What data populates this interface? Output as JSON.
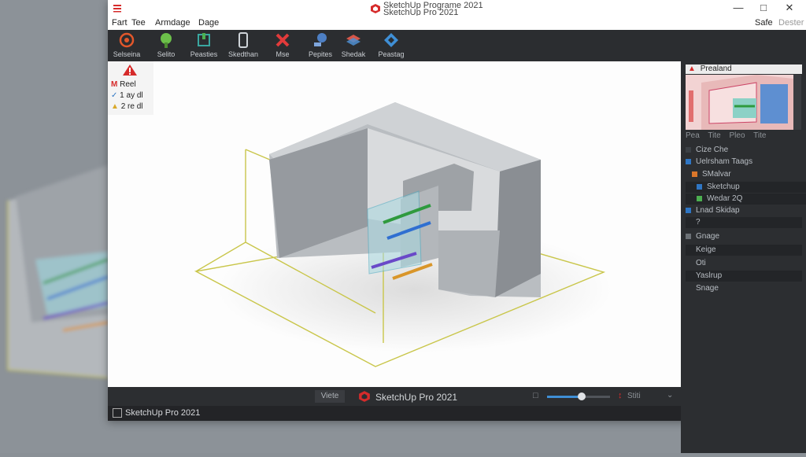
{
  "titlebar": {
    "title_line1": "SketchUp Programe 2021",
    "title_line2": "SketchUp Pro 2021",
    "right_labels": [
      "Safe",
      "Dester"
    ]
  },
  "menu": [
    "Fart",
    "Tee",
    "Armdage",
    "Dage"
  ],
  "toolbar": [
    {
      "label": "Selseina",
      "icon": "select-icon"
    },
    {
      "label": "Selito",
      "icon": "paint-icon"
    },
    {
      "label": "Peasties",
      "icon": "push-pull-icon"
    },
    {
      "label": "Skedthan",
      "icon": "device-icon"
    },
    {
      "label": "Mse",
      "icon": "erase-icon"
    },
    {
      "label": "Pepites",
      "icon": "tape-icon"
    },
    {
      "label": "Shedak",
      "icon": "layers-icon"
    },
    {
      "label": "Peastag",
      "icon": "orbit-icon"
    }
  ],
  "outliner": {
    "items": [
      "Reel",
      "1 ay dl",
      "2 re dl"
    ]
  },
  "statusbar": {
    "view_button": "Viete",
    "app_label": "SketchUp Pro 2021",
    "zoom_value": 0.55,
    "scale_label": "Stiti"
  },
  "taskbar": {
    "label": "SketchUp Pro 2021"
  },
  "panel": {
    "title": "Prealand",
    "subheader": [
      "Pea",
      "Tite",
      "Pleo",
      "Tite"
    ],
    "tree": [
      {
        "label": "Cize Che",
        "color": "#3b4045"
      },
      {
        "label": "Uelrsham Taags",
        "color": "#2f76c4"
      },
      {
        "label": "SMalvar",
        "color": "#d9762a"
      },
      {
        "label": "Sketchup",
        "color": "#2f76c4"
      },
      {
        "label": "Wedar 2Q",
        "color": "#4caf50"
      },
      {
        "label": "Lnad Skidap",
        "color": "#2f76c4"
      },
      {
        "label": "?",
        "color": ""
      },
      {
        "label": "Gnage",
        "color": "#6b7075"
      },
      {
        "label": "Keige",
        "color": ""
      },
      {
        "label": "Oti",
        "color": ""
      },
      {
        "label": "Yaslrup",
        "color": ""
      },
      {
        "label": "Snage",
        "color": ""
      }
    ]
  },
  "colors": {
    "accent_red": "#d62b2b",
    "toolbar_bg": "#2b2d30",
    "panel_bg": "#2c2e31",
    "x_axis": "#2f9a3e",
    "y_axis": "#2f6fd1",
    "z_axis": "#6a49c8",
    "guide_line": "#c9c64a"
  }
}
